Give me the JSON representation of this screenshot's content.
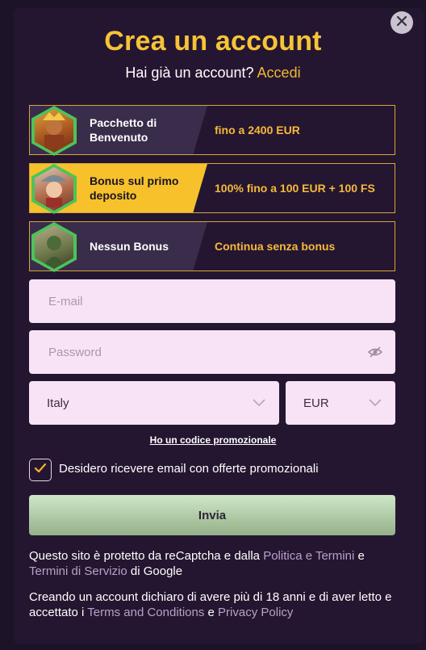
{
  "modal": {
    "title": "Crea un account",
    "subtitle_text": "Hai già un account?",
    "login_link": "Accedi"
  },
  "bonuses": [
    {
      "name": "Pacchetto di Benvenuto",
      "offer": "fino a 2400 EUR",
      "active": false
    },
    {
      "name": "Bonus sul primo deposito",
      "offer": "100% fino a 100 EUR + 100 FS",
      "active": true
    },
    {
      "name": "Nessun Bonus",
      "offer": "Continua senza bonus",
      "active": false
    }
  ],
  "form": {
    "email_placeholder": "E-mail",
    "password_placeholder": "Password",
    "country_value": "Italy",
    "currency_value": "EUR",
    "promo_link": "Ho un codice promozionale",
    "marketing_label": "Desidero ricevere email con offerte promozionali",
    "marketing_checked": true,
    "submit_label": "Invia"
  },
  "legal": {
    "recaptcha_prefix": "Questo sito è protetto da reCaptcha e dalla",
    "privacy_link": "Politica e Termini",
    "and1": "e",
    "terms_service_link": "Termini di Servizio",
    "recaptcha_suffix": "di Google",
    "age_prefix": "Creando un account dichiaro di avere più di 18 anni e di aver letto e accettato i",
    "tc_link": "Terms and Conditions",
    "and2": "e",
    "pp_link": "Privacy Policy"
  },
  "colors": {
    "accent": "#f6c338",
    "badge_green": "#4cc35a",
    "field_bg": "#f8e3f6",
    "modal_bg": "#241630"
  }
}
